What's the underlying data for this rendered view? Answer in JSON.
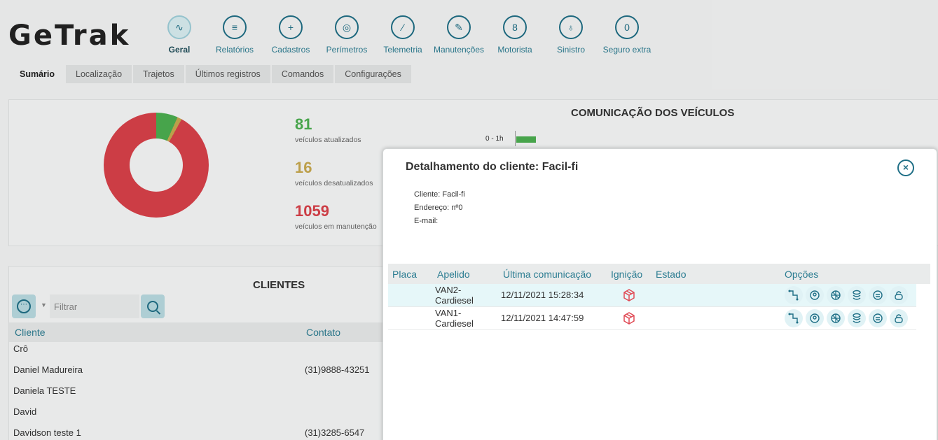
{
  "header": {
    "logo": "GeTrak",
    "nav": [
      {
        "label": "Geral",
        "icon": "monitor-chart-icon",
        "glyph": "∿",
        "active": true
      },
      {
        "label": "Relatórios",
        "icon": "report-icon",
        "glyph": "≡",
        "active": false
      },
      {
        "label": "Cadastros",
        "icon": "folder-plus-icon",
        "glyph": "+",
        "active": false
      },
      {
        "label": "Perímetros",
        "icon": "perimeter-target-icon",
        "glyph": "◎",
        "active": false
      },
      {
        "label": "Telemetria",
        "icon": "gauge-icon",
        "glyph": "⁄",
        "active": false
      },
      {
        "label": "Manutenções",
        "icon": "wrench-icon",
        "glyph": "✎",
        "active": false
      },
      {
        "label": "Motorista",
        "icon": "driver-icon",
        "glyph": "8",
        "active": false
      },
      {
        "label": "Sinistro",
        "icon": "alarm-siren-icon",
        "glyph": "♁",
        "active": false
      },
      {
        "label": "Seguro extra",
        "icon": "shield-lock-icon",
        "glyph": "0",
        "active": false
      }
    ]
  },
  "tabs": [
    "Sumário",
    "Localização",
    "Trajetos",
    "Últimos registros",
    "Comandos",
    "Configurações"
  ],
  "summary": {
    "stats": [
      {
        "value": "81",
        "label": "veículos atualizados",
        "color": "#4caf50"
      },
      {
        "value": "16",
        "label": "veículos desatualizados",
        "color": "#c8a94f"
      },
      {
        "value": "1059",
        "label": "veículos em manutenção",
        "color": "#d9414a"
      }
    ],
    "comm_title": "COMUNICAÇÃO DOS VEÍCULOS",
    "comm_row_label": "0 - 1h"
  },
  "clientes": {
    "title": "CLIENTES",
    "filter_placeholder": "Filtrar",
    "columns": [
      "Cliente",
      "Contato"
    ],
    "rows": [
      {
        "cliente": "Crô",
        "contato": ""
      },
      {
        "cliente": "Daniel Madureira",
        "contato": "(31)9888-43251"
      },
      {
        "cliente": "Daniela TESTE",
        "contato": ""
      },
      {
        "cliente": "David",
        "contato": ""
      },
      {
        "cliente": "Davidson teste 1",
        "contato": "(31)3285-6547"
      }
    ]
  },
  "modal": {
    "title": "Detalhamento do cliente: Facil-fi",
    "cliente": "Cliente: Facil-fi",
    "endereco": "Endereço: nº0",
    "email": "E-mail:",
    "columns": {
      "placa": "Placa",
      "apelido": "Apelido",
      "ultima": "Última comunicação",
      "ignicao": "Ignição",
      "estado": "Estado",
      "opcoes": "Opções"
    },
    "rows": [
      {
        "apelido_1": "VAN2-",
        "apelido_2": "Cardiesel",
        "ultima": "12/11/2021 15:28:34"
      },
      {
        "apelido_1": "VAN1-",
        "apelido_2": "Cardiesel",
        "ultima": "12/11/2021 14:47:59"
      }
    ]
  }
}
